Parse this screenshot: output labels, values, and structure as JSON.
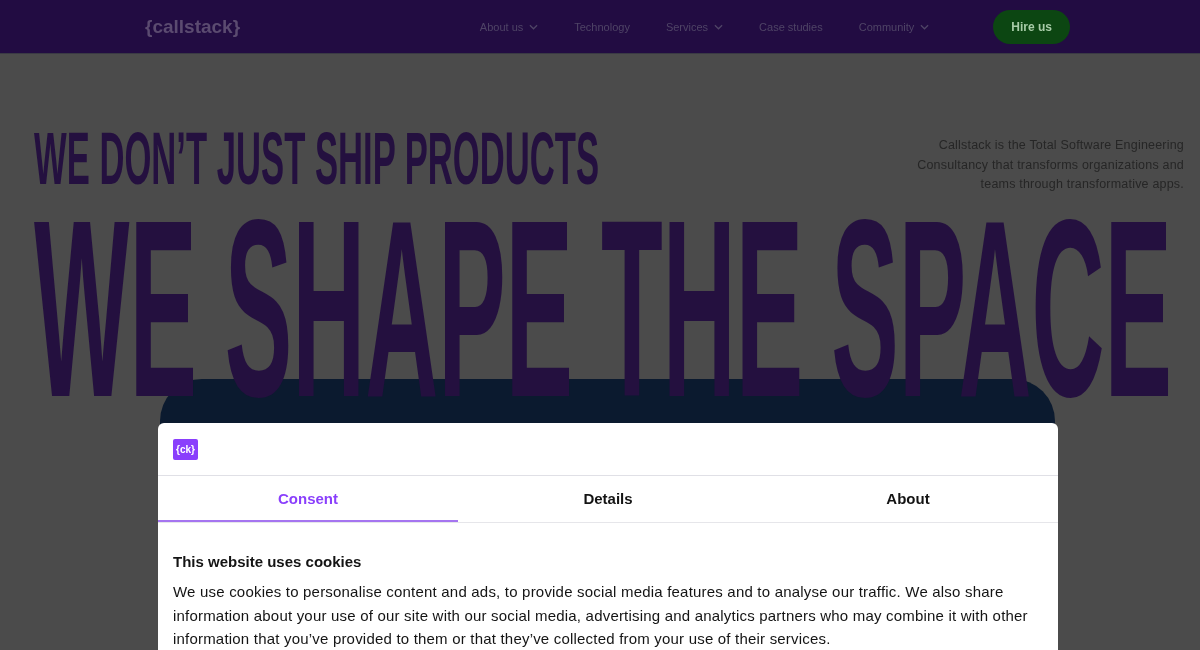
{
  "nav": {
    "logo": "{callstack}",
    "items": [
      {
        "label": "About us",
        "has_menu": true
      },
      {
        "label": "Technology",
        "has_menu": false
      },
      {
        "label": "Services",
        "has_menu": true
      },
      {
        "label": "Case studies",
        "has_menu": false
      },
      {
        "label": "Community",
        "has_menu": true
      }
    ],
    "cta": "Hire us"
  },
  "hero": {
    "kicker": "WE DON’T JUST SHIP PRODUCTS",
    "headline": "WE SHAPE THE SPACE",
    "description": "Callstack is the Total Software Engineering Consultancy that transforms organizations and teams through transformative apps."
  },
  "cookie_dialog": {
    "logo": "{ck}",
    "tabs": [
      {
        "label": "Consent",
        "selected": true
      },
      {
        "label": "Details",
        "selected": false
      },
      {
        "label": "About",
        "selected": false
      }
    ],
    "title": "This website uses cookies",
    "body": "We use cookies to personalise content and ads, to provide social media features and to analyse our traffic. We also share information about your use of our site with our social media, advertising and analytics partners who may combine it with other information that you’ve provided to them or that they’ve collected from your use of their services."
  }
}
